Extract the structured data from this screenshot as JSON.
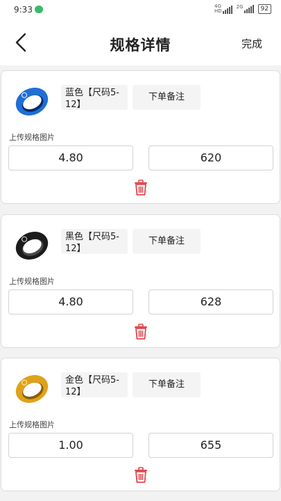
{
  "status": {
    "time": "9:33",
    "net1": "4G",
    "net2": "2G",
    "hd": "HD",
    "battery": "92"
  },
  "nav": {
    "title": "规格详情",
    "done": "完成"
  },
  "specs": [
    {
      "color_label": "蓝色【尺码5-12】",
      "remark_label": "下单备注",
      "upload_label": "上传规格图片",
      "price": "4.80",
      "stock": "620",
      "ring_color": "#1f6fd6"
    },
    {
      "color_label": "黑色【尺码5-12】",
      "remark_label": "下单备注",
      "upload_label": "上传规格图片",
      "price": "4.80",
      "stock": "628",
      "ring_color": "#1c1c1c"
    },
    {
      "color_label": "金色【尺码5-12】",
      "remark_label": "下单备注",
      "upload_label": "上传规格图片",
      "price": "1.00",
      "stock": "655",
      "ring_color": "#e0a21a"
    }
  ],
  "icons": {
    "back": "back-arrow-icon",
    "delete": "trash-icon"
  },
  "colors": {
    "delete_icon": "#e0474c"
  }
}
